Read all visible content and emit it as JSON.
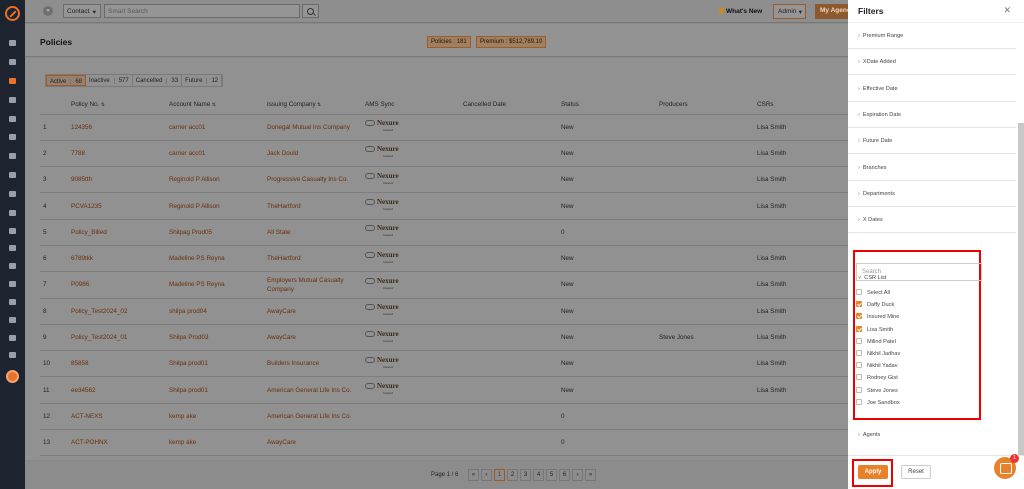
{
  "topbar": {
    "search_type": "Contact",
    "search_placeholder": "Smart Search",
    "whats_new": "What's New",
    "admin_label": "Admin",
    "my_agency": "My Agency"
  },
  "page": {
    "title": "Policies",
    "policies_pill": "Policies : 181",
    "premium_pill": "Premium : $512,789.10"
  },
  "status_tabs": [
    {
      "label": "Active",
      "count": "68"
    },
    {
      "label": "Inactive",
      "count": "577"
    },
    {
      "label": "Cancelled",
      "count": "33"
    },
    {
      "label": "Future",
      "count": "12"
    }
  ],
  "table": {
    "headers": [
      "",
      "Policy No.",
      "Account Name",
      "Issuing Company",
      "AMS Sync",
      "Cancelled Date",
      "Status",
      "Producers",
      "CSRs"
    ],
    "ams_logo_text": "Nexure",
    "ams_logo_sub": "Insured",
    "rows": [
      {
        "n": "1",
        "policy": "124356",
        "account": "carrier acc01",
        "company": "Donegal Mutual Ins Company",
        "ams": true,
        "cancelled": "",
        "status": "New",
        "producer": "",
        "csr": "Lisa Smith"
      },
      {
        "n": "2",
        "policy": "7788",
        "account": "carrier acc01",
        "company": "Jack Dould",
        "ams": true,
        "cancelled": "",
        "status": "New",
        "producer": "",
        "csr": "Lisa Smith"
      },
      {
        "n": "3",
        "policy": "9085tth",
        "account": "Reginold P Allison",
        "company": "Progressive Casualty Ins Co.",
        "ams": true,
        "cancelled": "",
        "status": "New",
        "producer": "",
        "csr": "Lisa Smith"
      },
      {
        "n": "4",
        "policy": "PCVA1235",
        "account": "Reginold P Allison",
        "company": "TheHartford",
        "ams": true,
        "cancelled": "",
        "status": "New",
        "producer": "",
        "csr": "Lisa Smith"
      },
      {
        "n": "5",
        "policy": "Policy_Billed",
        "account": "Shilpag Prod05",
        "company": "All State",
        "ams": true,
        "cancelled": "",
        "status": "0",
        "producer": "",
        "csr": ""
      },
      {
        "n": "6",
        "policy": "6789tkk",
        "account": "Madeline PS Reyna",
        "company": "TheHartford",
        "ams": true,
        "cancelled": "",
        "status": "New",
        "producer": "",
        "csr": "Lisa Smith"
      },
      {
        "n": "7",
        "policy": "P0986",
        "account": "Madeline PS Reyna",
        "company": "Employers Mutual Casualty Company",
        "ams": true,
        "cancelled": "",
        "status": "New",
        "producer": "",
        "csr": "Lisa Smith"
      },
      {
        "n": "8",
        "policy": "Policy_Test2024_02",
        "account": "shilpa prod04",
        "company": "AwayCare",
        "ams": true,
        "cancelled": "",
        "status": "New",
        "producer": "",
        "csr": "Lisa Smith"
      },
      {
        "n": "9",
        "policy": "Policy_Test2024_01",
        "account": "Shilpa Prod03",
        "company": "AwayCare",
        "ams": true,
        "cancelled": "",
        "status": "New",
        "producer": "Steve Jones",
        "csr": "Lisa Smith"
      },
      {
        "n": "10",
        "policy": "85858",
        "account": "Shilpa prod01",
        "company": "Builders Insurance",
        "ams": true,
        "cancelled": "",
        "status": "New",
        "producer": "",
        "csr": "Lisa Smith"
      },
      {
        "n": "11",
        "policy": "ee34562",
        "account": "Shilpa prod01",
        "company": "American General Life Ins Co.",
        "ams": true,
        "cancelled": "",
        "status": "New",
        "producer": "",
        "csr": "Lisa Smith"
      },
      {
        "n": "12",
        "policy": "ACT-NEXS",
        "account": "kemp ake",
        "company": "American General Life Ins Co.",
        "ams": false,
        "cancelled": "",
        "status": "0",
        "producer": "",
        "csr": ""
      },
      {
        "n": "13",
        "policy": "ACT-POHNX",
        "account": "kemp ake",
        "company": "AwayCare",
        "ams": false,
        "cancelled": "",
        "status": "0",
        "producer": "",
        "csr": ""
      }
    ]
  },
  "pagination": {
    "info": "Page 1 / 6",
    "buttons": [
      "«",
      "‹",
      "1",
      "2",
      "3",
      "4",
      "5",
      "6",
      "›",
      "»"
    ],
    "current": "1"
  },
  "filters": {
    "title": "Filters",
    "sections_top": [
      "Premium Range",
      "XDate Added",
      "Effective Date",
      "Expiration Date",
      "Future Date",
      "Branches",
      "Departments",
      "X Dates"
    ],
    "csr_title": "CSR List",
    "csr_search_placeholder": "Search",
    "csr_items": [
      {
        "label": "Select All",
        "checked": false
      },
      {
        "label": "Daffy Duck",
        "checked": true
      },
      {
        "label": "Insured Mine",
        "checked": true
      },
      {
        "label": "Lisa Smith",
        "checked": true
      },
      {
        "label": "Milind Patel",
        "checked": false
      },
      {
        "label": "Nikhil Jadhav",
        "checked": false
      },
      {
        "label": "Nikhil Yadav",
        "checked": false
      },
      {
        "label": "Rodney Gist",
        "checked": false
      },
      {
        "label": "Steve Jones",
        "checked": false
      },
      {
        "label": "Joe Sandbox",
        "checked": false
      }
    ],
    "sections_bottom": [
      "Agents"
    ],
    "apply_label": "Apply",
    "reset_label": "Reset"
  },
  "chat_badge": "1",
  "colors": {
    "accent": "#e8822a",
    "sidebar": "#1e2330",
    "highlight_box": "#ee0000"
  }
}
